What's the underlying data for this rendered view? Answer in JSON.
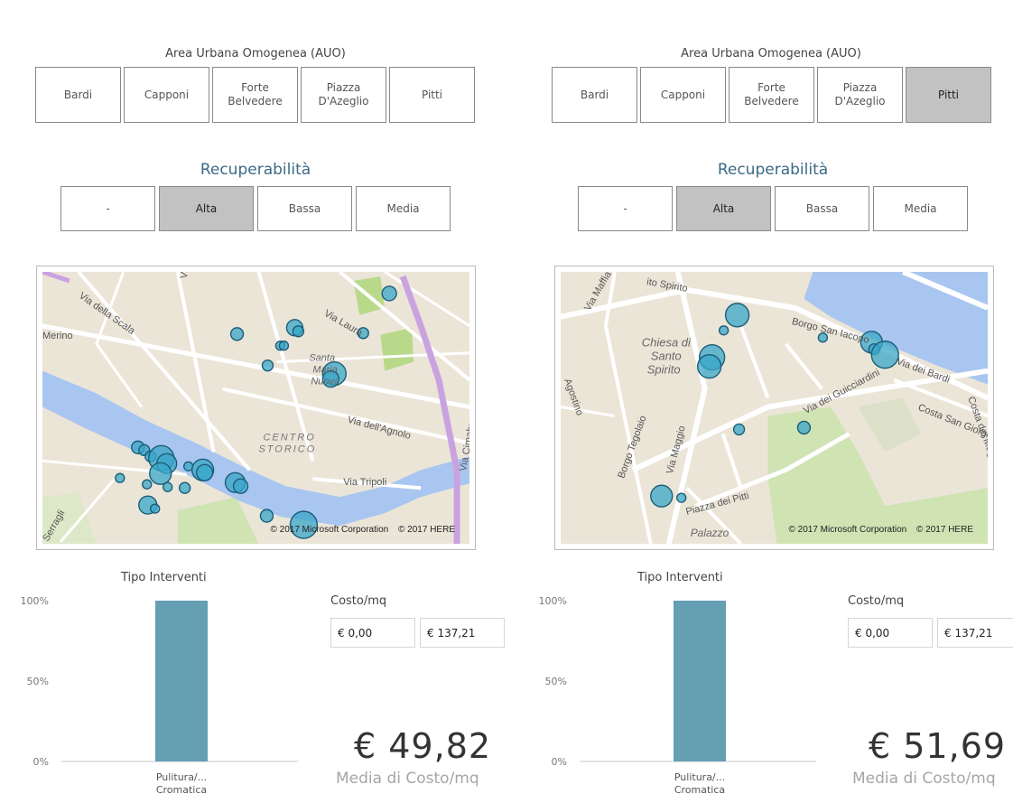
{
  "panels": [
    {
      "auo": {
        "title": "Area Urbana Omogenea (AUO)",
        "buttons": [
          "Bardi",
          "Capponi",
          "Forte\nBelvedere",
          "Piazza\nD'Azeglio",
          "Pitti"
        ],
        "selected": []
      },
      "recuperabilita": {
        "title": "Recuperabilità",
        "buttons": [
          "-",
          "Alta",
          "Bassa",
          "Media"
        ],
        "selected": "Alta"
      },
      "map": {
        "labels": [
          "Via della Scala",
          "Via Faenza",
          "Via Laura",
          "Santa",
          "Maria",
          "Nuova",
          "CENTRO",
          "STORICO",
          "Via dell'Agnolo",
          "Via Tripoli",
          "Via Cimabue",
          "Serragli",
          "Merino"
        ],
        "copyright_ms": "© 2017 Microsoft Corporation",
        "copyright_here": "© 2017 HERE",
        "bubble_color": "#3aa6c8"
      },
      "chart": {
        "title": "Tipo Interventi",
        "y_ticks": [
          "100%",
          "50%",
          "0%"
        ],
        "category_line1": "Pulitura/...",
        "category_line2": "Cromatica"
      },
      "costo": {
        "label": "Costo/mq",
        "min_value": "€ 0,00",
        "max_value": "€ 137,21"
      },
      "kpi": {
        "value": "€ 49,82",
        "label": "Media di Costo/mq"
      }
    },
    {
      "auo": {
        "title": "Area Urbana Omogenea (AUO)",
        "buttons": [
          "Bardi",
          "Capponi",
          "Forte\nBelvedere",
          "Piazza\nD'Azeglio",
          "Pitti"
        ],
        "selected": [
          "Pitti"
        ]
      },
      "recuperabilita": {
        "title": "Recuperabilità",
        "buttons": [
          "-",
          "Alta",
          "Bassa",
          "Media"
        ],
        "selected": "Alta"
      },
      "map": {
        "labels": [
          "ito Spirito",
          "Via Maffia",
          "Borgo San Iacopo",
          "Chiesa di",
          "Santo",
          "Spirito",
          "Via dei Bardi",
          "Via dei Guicciardini",
          "Costa San Giorgio",
          "Costa dei Magnoli",
          "Borgo Tegolaio",
          "Via Maggio",
          "Piazza dei Pitti",
          "Palazzo",
          "Agostino"
        ],
        "copyright_ms": "© 2017 Microsoft Corporation",
        "copyright_here": "© 2017 HERE",
        "bubble_color": "#3aa6c8"
      },
      "chart": {
        "title": "Tipo Interventi",
        "y_ticks": [
          "100%",
          "50%",
          "0%"
        ],
        "category_line1": "Pulitura/...",
        "category_line2": "Cromatica"
      },
      "costo": {
        "label": "Costo/mq",
        "min_value": "€ 0,00",
        "max_value": "€ 137,21"
      },
      "kpi": {
        "value": "€ 51,69",
        "label": "Media di Costo/mq"
      }
    }
  ],
  "chart_data": [
    {
      "type": "bar",
      "title": "Tipo Interventi",
      "categories": [
        "Pulitura/... Cromatica"
      ],
      "values": [
        100
      ],
      "ylim": [
        0,
        100
      ],
      "y_unit": "%",
      "color": "#649fb3",
      "grid": false
    },
    {
      "type": "bar",
      "title": "Tipo Interventi",
      "categories": [
        "Pulitura/... Cromatica"
      ],
      "values": [
        100
      ],
      "ylim": [
        0,
        100
      ],
      "y_unit": "%",
      "color": "#649fb3",
      "grid": false
    }
  ]
}
